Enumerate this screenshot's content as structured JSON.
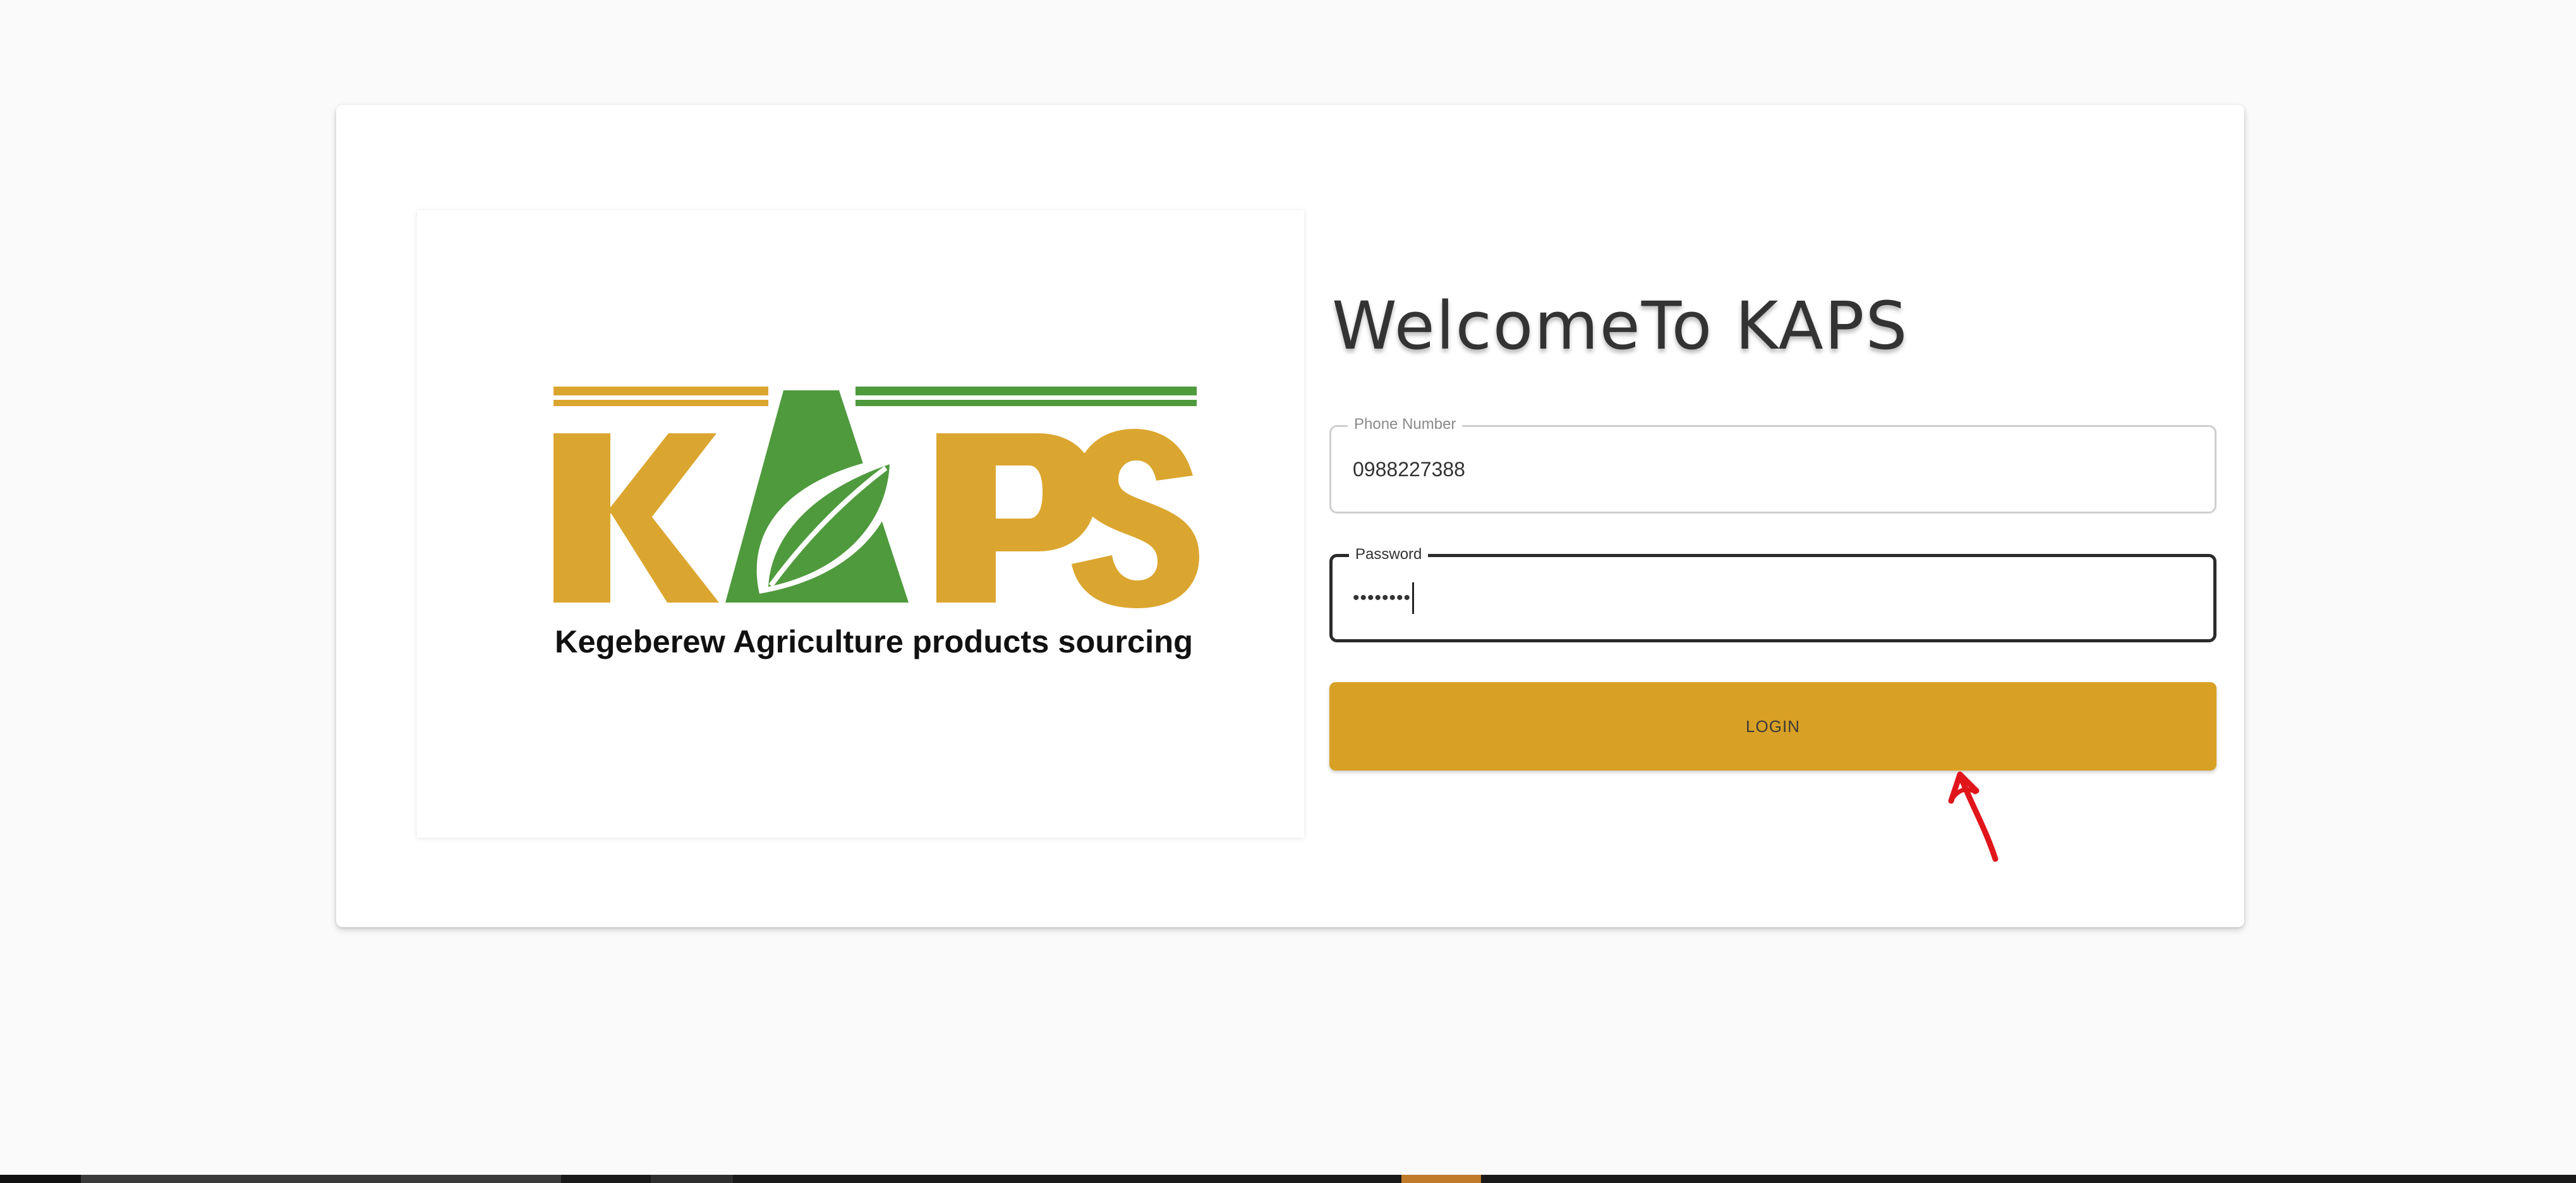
{
  "logo": {
    "wordmark": "KAPS",
    "tagline": "Kegeberew Agriculture products sourcing"
  },
  "login_form": {
    "title": "WelcomeTo KAPS",
    "phone": {
      "label": "Phone Number",
      "value": "0988227388"
    },
    "password": {
      "label": "Password",
      "masked_value": "••••••••"
    },
    "login_button": "LOGIN"
  },
  "annotation": {
    "icon": "red-hand-drawn-arrow-icon"
  },
  "colors": {
    "brand_gold": "#d8a024",
    "logo_gold": "#dba62f",
    "logo_green": "#4f9a3d",
    "annotation_red": "#e0161b",
    "page_background": "#fafafa"
  }
}
